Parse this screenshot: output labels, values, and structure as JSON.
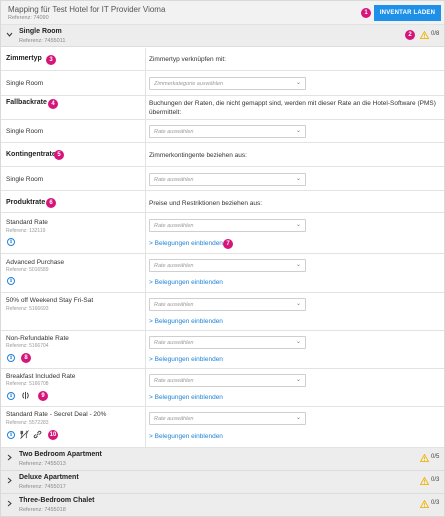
{
  "header": {
    "title": "Mapping für Test Hotel for IT Provider Vioma",
    "reference": "Referenz: 74090",
    "inventory_button": "INVENTAR LADEN"
  },
  "badges": [
    "1",
    "2",
    "3",
    "4",
    "5",
    "6",
    "7",
    "8",
    "9",
    "10"
  ],
  "single_room": {
    "name": "Single Room",
    "reference": "Referenz: 7455011",
    "count": "0/8"
  },
  "zimmertyp": {
    "label": "Zimmertyp",
    "description": "Zimmertyp verknüpfen mit:",
    "row_label": "Single Room",
    "placeholder": "Zimmerkategorie auswählen"
  },
  "fallbackrate": {
    "label": "Fallbackrate",
    "description": "Buchungen der Raten, die nicht gemappt sind, werden mit dieser Rate an die Hotel-Software (PMS) übermittelt:",
    "row_label": "Single Room",
    "placeholder": "Rate auswählen"
  },
  "kontingentrate": {
    "label": "Kontingentrate",
    "description": "Zimmerkontingente beziehen aus:",
    "row_label": "Single Room",
    "placeholder": "Rate auswählen"
  },
  "produktrate": {
    "label": "Produktrate",
    "description": "Preise und Restriktionen beziehen aus:"
  },
  "rates": [
    {
      "name": "Standard Rate",
      "ref": "Referenz: 132119",
      "placeholder": "Rate auswählen",
      "link": "Belegungen einblenden"
    },
    {
      "name": "Advanced Purchase",
      "ref": "Referenz: 5016589",
      "placeholder": "Rate auswählen",
      "link": "Belegungen einblenden"
    },
    {
      "name": "50% off Weekend Stay Fri-Sat",
      "ref": "Referenz: 5166693",
      "placeholder": "Rate auswählen",
      "link": "Belegungen einblenden"
    },
    {
      "name": "Non-Refundable Rate",
      "ref": "Referenz: 5166704",
      "placeholder": "Rate auswählen",
      "link": "Belegungen einblenden"
    },
    {
      "name": "Breakfast Included Rate",
      "ref": "Referenz: 5166708",
      "placeholder": "Rate auswählen",
      "link": "Belegungen einblenden"
    },
    {
      "name": "Standard Rate - Secret Deal - 20%",
      "ref": "Referenz: 5572283",
      "placeholder": "Rate auswählen",
      "link": "Belegungen einblenden"
    }
  ],
  "rooms_collapsed": [
    {
      "name": "Two Bedroom Apartment",
      "ref": "Referenz: 7455013",
      "count": "0/5"
    },
    {
      "name": "Deluxe Apartment",
      "ref": "Referenz: 7455017",
      "count": "0/3"
    },
    {
      "name": "Three-Bedroom Chalet",
      "ref": "Referenz: 7455018",
      "count": "0/3"
    }
  ],
  "colors": {
    "accent": "#1e90e8",
    "badge": "#d6157a",
    "warning": "#f0b400",
    "link": "#1e82d8"
  },
  "icons": [
    "info-icon",
    "no-breakfast-icon",
    "non-refundable-icon",
    "link-icon",
    "warning-icon",
    "chevron-down-icon",
    "chevron-right-icon"
  ]
}
